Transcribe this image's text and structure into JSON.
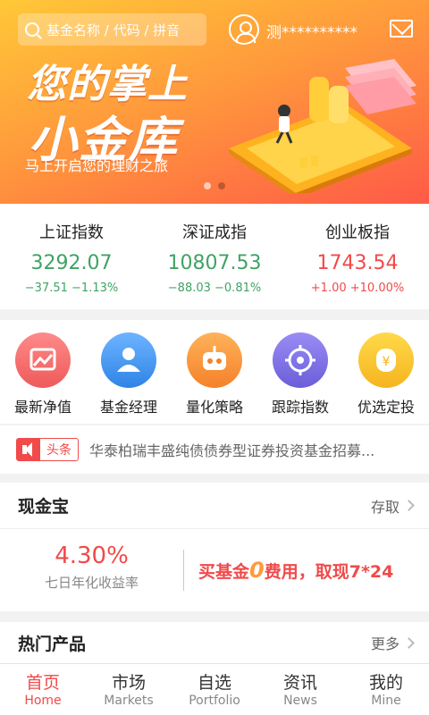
{
  "header": {
    "search_placeholder": "基金名称 / 代码 / 拼音",
    "username": "测**********"
  },
  "banner": {
    "title_line1": "您的掌上",
    "title_line2": "小金库",
    "subtitle": "马上开启您的理财之旅"
  },
  "indices": [
    {
      "name": "上证指数",
      "value": "3292.07",
      "change": "−37.51  −1.13%"
    },
    {
      "name": "深证成指",
      "value": "10807.53",
      "change": "−88.03  −0.81%"
    },
    {
      "name": "创业板指",
      "value": "1743.54",
      "change": "+1.00  +10.00%"
    }
  ],
  "shortcuts": [
    {
      "label": "最新净值",
      "icon": "chart-icon",
      "color": "#f26b6b"
    },
    {
      "label": "基金经理",
      "icon": "manager-icon",
      "color": "#3b8fe8"
    },
    {
      "label": "量化策略",
      "icon": "robot-icon",
      "color": "#f89a3c"
    },
    {
      "label": "跟踪指数",
      "icon": "target-icon",
      "color": "#7b6ee0"
    },
    {
      "label": "优选定投",
      "icon": "coin-icon",
      "color": "#f7c52f"
    }
  ],
  "headline": {
    "tag": "头条",
    "text": "华泰柏瑞丰盛纯债债券型证券投资基金招募..."
  },
  "cash": {
    "title": "现金宝",
    "action": "存取",
    "yield": "4.30%",
    "yield_label": "七日年化收益率",
    "promo_prefix": "买基金",
    "promo_zero": "0",
    "promo_suffix": "费用，取现7*24"
  },
  "hot": {
    "title": "热门产品",
    "more": "更多"
  },
  "tabs": [
    {
      "cn": "首页",
      "en": "Home"
    },
    {
      "cn": "市场",
      "en": "Markets"
    },
    {
      "cn": "自选",
      "en": "Portfolio"
    },
    {
      "cn": "资讯",
      "en": "News"
    },
    {
      "cn": "我的",
      "en": "Mine"
    }
  ],
  "colors": {
    "accent": "#f04a4a",
    "up": "#f04a4a",
    "down": "#3fa363"
  }
}
